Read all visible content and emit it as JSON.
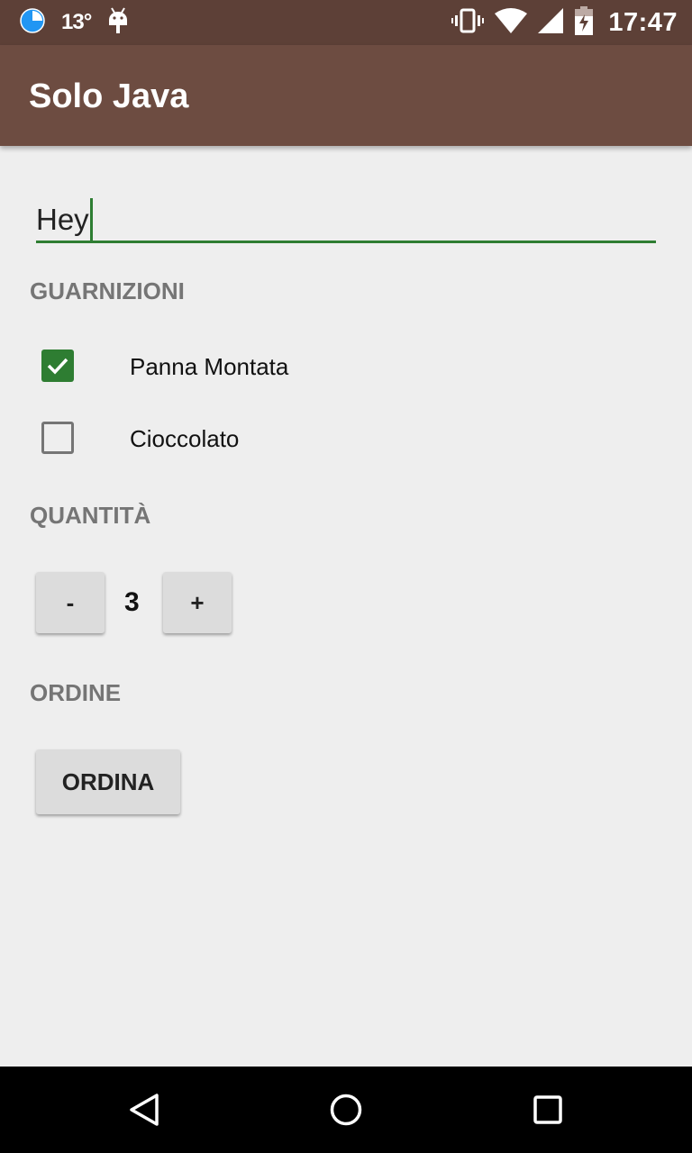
{
  "status_bar": {
    "temperature": "13°",
    "time": "17:47",
    "icons": [
      "data-saver-icon",
      "android-icon",
      "vibrate-icon",
      "wifi-icon",
      "signal-icon",
      "battery-charging-icon"
    ]
  },
  "app_bar": {
    "title": "Solo Java"
  },
  "name_input": {
    "value": "Hey"
  },
  "toppings": {
    "header": "GUARNIZIONI",
    "items": [
      {
        "label": "Panna Montata",
        "checked": true
      },
      {
        "label": "Cioccolato",
        "checked": false
      }
    ]
  },
  "quantity": {
    "header": "QUANTITÀ",
    "decrement_label": "-",
    "value": "3",
    "increment_label": "+"
  },
  "order": {
    "header": "ORDINE",
    "button_label": "ORDINA"
  },
  "nav_bar": {
    "icons": [
      "back-icon",
      "home-icon",
      "recents-icon"
    ]
  },
  "colors": {
    "status_bar": "#5d4037",
    "app_bar": "#6d4c41",
    "accent": "#2e7d32",
    "background": "#eeeeee"
  }
}
